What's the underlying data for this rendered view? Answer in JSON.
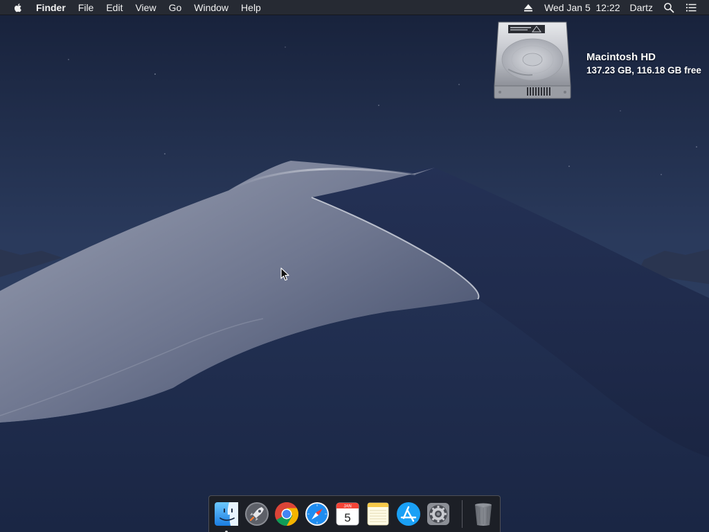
{
  "menubar": {
    "app_name": "Finder",
    "menus": [
      "File",
      "Edit",
      "View",
      "Go",
      "Window",
      "Help"
    ],
    "clock": "Wed Jan 5  12:22",
    "user": "Dartz"
  },
  "desktop": {
    "drive": {
      "name": "Macintosh HD",
      "capacity": "137.23 GB, 116.18 GB free"
    }
  },
  "dock": {
    "apps": [
      {
        "name": "Finder",
        "icon": "finder-icon",
        "running": true
      },
      {
        "name": "Launchpad",
        "icon": "launchpad-icon",
        "running": false
      },
      {
        "name": "Google Chrome",
        "icon": "chrome-icon",
        "running": false
      },
      {
        "name": "Safari",
        "icon": "safari-icon",
        "running": false
      },
      {
        "name": "Calendar",
        "icon": "calendar-icon",
        "running": false
      },
      {
        "name": "Notes",
        "icon": "notes-icon",
        "running": false
      },
      {
        "name": "App Store",
        "icon": "app-store-icon",
        "running": false
      },
      {
        "name": "System Preferences",
        "icon": "system-preferences-icon",
        "running": false
      },
      {
        "name": "Trash",
        "icon": "trash-icon",
        "running": false
      }
    ],
    "calendar": {
      "month": "JAN",
      "day": "5"
    }
  },
  "colors": {
    "menubar_bg": "#262a33",
    "sky_top": "#17213a",
    "dune_light": "#8f96a8",
    "dune_dark": "#1f2a4a"
  }
}
